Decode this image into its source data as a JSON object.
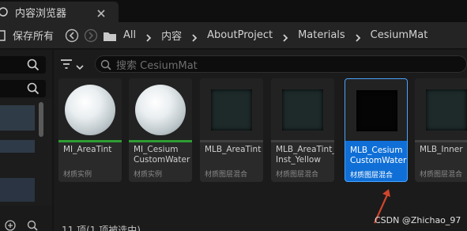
{
  "tab": {
    "label": "内容浏览器"
  },
  "toolbar": {
    "save_all_label": "保存所有",
    "breadcrumbs": [
      "All",
      "内容",
      "AboutProject",
      "Materials",
      "CesiumMat"
    ]
  },
  "search": {
    "placeholder": "搜索 CesiumMat"
  },
  "assets": [
    {
      "name": "MI_AreaTint",
      "type": "材质实例",
      "thumb": "sphere",
      "bar_color": "#2f9e34",
      "selected": false
    },
    {
      "name": "MI_Cesium\nCustomWater",
      "type": "材质实例",
      "thumb": "sphere",
      "bar_color": "#2f9e34",
      "selected": false
    },
    {
      "name": "MLB_AreaTint",
      "type": "材质图层混合",
      "thumb": "checker",
      "bar_color": "#404040",
      "selected": false
    },
    {
      "name": "MLB_AreaTint_\nInst_Yellow",
      "type": "材质图层混合",
      "thumb": "checker",
      "bar_color": "#404040",
      "selected": false
    },
    {
      "name": "MLB_Cesium\nCustomWater",
      "type": "材质图层混合",
      "thumb": "checker-dark",
      "bar_color": "#0f6fd6",
      "selected": true
    },
    {
      "name": "MLB_Inner",
      "type": "材质图层混合",
      "thumb": "checker",
      "bar_color": "#404040",
      "selected": false
    }
  ],
  "status": "11 项(1 项被选中)",
  "watermark": "CSDN @Zhichao_97",
  "colors": {
    "accent": "#0f6fd6",
    "instance_bar": "#2f9e34"
  }
}
